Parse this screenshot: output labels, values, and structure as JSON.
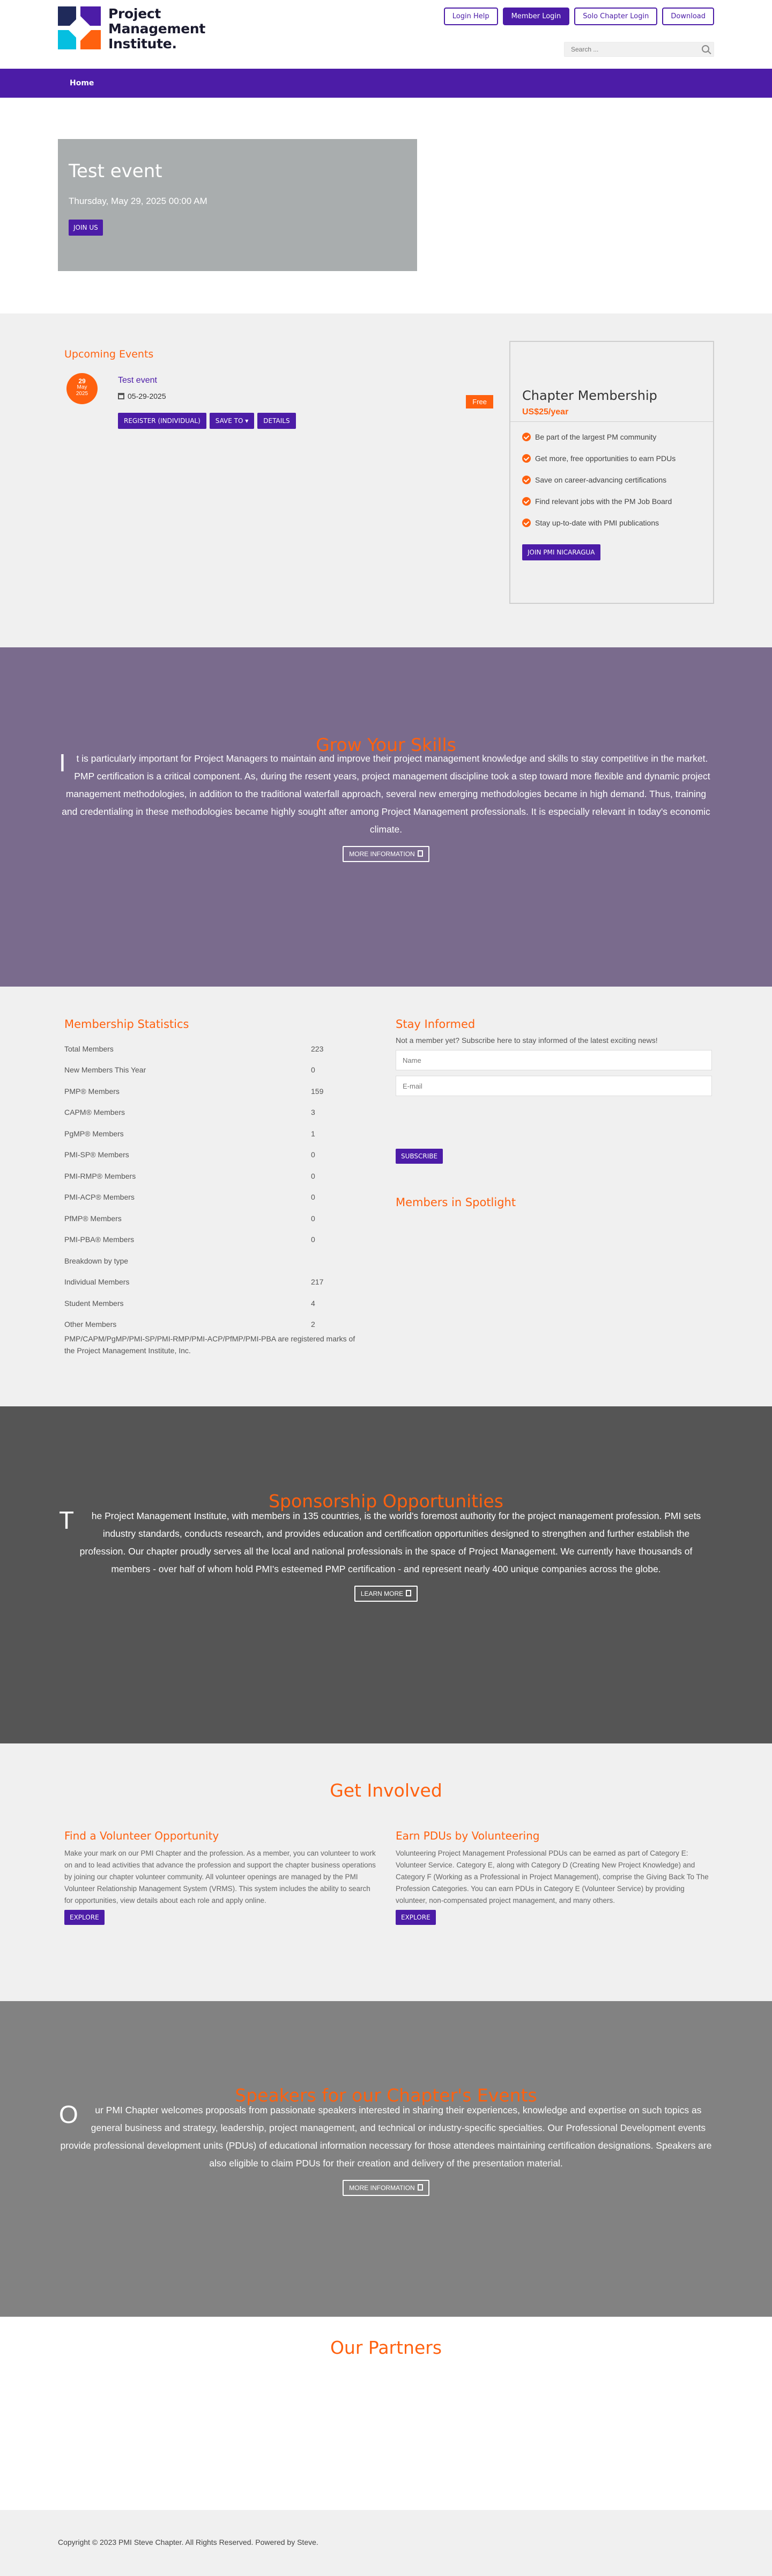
{
  "logo": {
    "line1": "Project",
    "line2": "Management",
    "line3": "Institute."
  },
  "top_buttons": {
    "login_help": "Login Help",
    "member_login": "Member Login",
    "solo_login": "Solo Chapter Login",
    "download": "Download"
  },
  "search": {
    "placeholder": "Search ..."
  },
  "nav": {
    "home": "Home"
  },
  "hero": {
    "title": "Test event",
    "date": "Thursday, May 29, 2025 00:00 AM",
    "join": "JOIN US"
  },
  "events": {
    "heading": "Upcoming Events",
    "badge_day": "29",
    "badge_month": "May",
    "badge_year": "2025",
    "title": "Test event",
    "date": "05-29-2025",
    "register": "REGISTER (INDIVIDUAL)",
    "save_to": "SAVE TO",
    "details": "DETAILS",
    "free": "Free"
  },
  "membership": {
    "title": "Chapter Membership",
    "price": "US$25/year",
    "benefits": [
      "Be part of the largest PM community",
      "Get more, free opportunities to earn PDUs",
      "Save on career-advancing certifications",
      "Find relevant jobs with the PM Job Board",
      "Stay up-to-date with PMI publications"
    ],
    "join": "JOIN PMI NICARAGUA"
  },
  "skills": {
    "title": "Grow Your Skills",
    "dropcap": "I",
    "text": "t is particularly important for Project Managers to maintain and improve their project management knowledge and skills to stay competitive in the market. PMP certification is a critical component. As, during the resent years, project management discipline took a step toward more flexible and dynamic project management methodologies, in addition to the traditional waterfall approach, several new emerging methodologies became in high demand. Thus, training and credentialing in these methodologies became highly sought after among Project Management professionals. It is especially relevant in today's economic climate.",
    "button": "MORE INFORMATION"
  },
  "stats": {
    "title": "Membership Statistics",
    "rows": [
      {
        "k": "Total Members",
        "v": "223"
      },
      {
        "k": "New Members This Year",
        "v": "0"
      },
      {
        "k": "PMP® Members",
        "v": "159"
      },
      {
        "k": "CAPM® Members",
        "v": "3"
      },
      {
        "k": "PgMP® Members",
        "v": "1"
      },
      {
        "k": "PMI-SP® Members",
        "v": "0"
      },
      {
        "k": "PMI-RMP® Members",
        "v": "0"
      },
      {
        "k": "PMI-ACP® Members",
        "v": "0"
      },
      {
        "k": "PfMP® Members",
        "v": "0"
      },
      {
        "k": "PMI-PBA® Members",
        "v": "0"
      },
      {
        "k": "Breakdown by type",
        "v": ""
      },
      {
        "k": "Individual Members",
        "v": "217"
      },
      {
        "k": "Student Members",
        "v": "4"
      },
      {
        "k": "Other Members",
        "v": "2"
      }
    ],
    "note": "PMP/CAPM/PgMP/PMI-SP/PMI-RMP/PMI-ACP/PfMP/PMI-PBA are registered marks of the Project Management Institute, Inc."
  },
  "informed": {
    "title": "Stay Informed",
    "sub": "Not a member yet? Subscribe here to stay informed of the latest exciting news!",
    "name": "Name",
    "email": "E-mail",
    "subscribe": "SUBSCRIBE",
    "spotlight": "Members in Spotlight"
  },
  "sponsor": {
    "title": "Sponsorship Opportunities",
    "dropcap": "T",
    "text": "he Project Management Institute, with members in 135 countries, is the world's foremost authority for the project management profession. PMI sets industry standards, conducts research, and provides education and certification opportunities designed to strengthen and further establish the profession. Our chapter proudly serves all the local and national professionals in the space of Project Management. We currently have thousands of members - over half of whom hold PMI's esteemed PMP certification - and represent nearly 400 unique companies across the globe.",
    "button": "LEARN MORE"
  },
  "involved": {
    "title": "Get Involved",
    "vol_title": "Find a Volunteer Opportunity",
    "vol_text": "Make your mark on our PMI Chapter and the profession. As a member, you can volunteer to work on and to lead activities that advance the profession and support the chapter business operations by joining our chapter volunteer community. All volunteer openings are managed by the PMI Volunteer Relationship Management System (VRMS). This system includes the ability to search for opportunities, view details about each role and apply online.",
    "pdu_title": "Earn PDUs by Volunteering",
    "pdu_text": "Volunteering Project Management Professional PDUs can be earned as part of Category E: Volunteer Service. Category E, along with Category D (Creating New Project Knowledge) and Category F (Working as a Professional in Project Management), comprise the Giving Back To The Profession Categories. You can earn PDUs in Category E (Volunteer Service) by providing volunteer, non-compensated project management, and many others.",
    "explore": "EXPLORE"
  },
  "speakers": {
    "title": "Speakers for our Chapter's Events",
    "dropcap": "O",
    "text": "ur PMI Chapter welcomes proposals from passionate speakers interested in sharing their experiences, knowledge and expertise on such topics as general business and strategy, leadership, project management, and technical or industry-specific specialties. Our Professional Development events provide professional development units (PDUs) of educational information necessary for those attendees maintaining certification designations. Speakers are also eligible to claim PDUs for their creation and delivery of the presentation material.",
    "button": "MORE INFORMATION"
  },
  "partners": {
    "title": "Our Partners"
  },
  "footer": {
    "text": "Copyright © 2023 PMI Steve Chapter. All Rights Reserved. Powered by Steve."
  },
  "colors": {
    "purple": "#4c1ca7",
    "orange": "#ff610f"
  }
}
